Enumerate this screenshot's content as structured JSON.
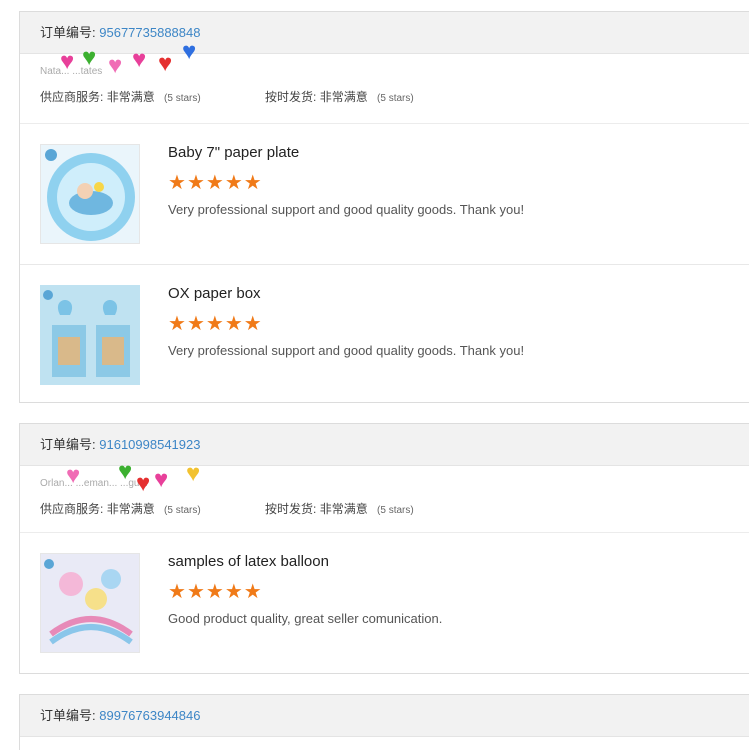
{
  "orders": [
    {
      "label": "订单编号:",
      "number": "95677735888848",
      "buyer": "Nata... ...tates",
      "supplier_label": "供应商服务:",
      "supplier_value": "非常满意",
      "supplier_stars": "(5 stars)",
      "shipping_label": "按时发货:",
      "shipping_value": "非常满意",
      "shipping_stars": "(5 stars)",
      "products": [
        {
          "title": "Baby 7\" paper plate",
          "rating": 5,
          "review": "Very professional support and good quality goods. Thank you!"
        },
        {
          "title": "OX paper box",
          "rating": 5,
          "review": "Very professional support and good quality goods. Thank you!"
        }
      ]
    },
    {
      "label": "订单编号:",
      "number": "91610998541923",
      "buyer": "Orlan... ...eman... ...gu...",
      "supplier_label": "供应商服务:",
      "supplier_value": "非常满意",
      "supplier_stars": "(5 stars)",
      "shipping_label": "按时发货:",
      "shipping_value": "非常满意",
      "shipping_stars": "(5 stars)",
      "products": [
        {
          "title": "samples of latex balloon",
          "rating": 5,
          "review": "Good product quality, great seller comunication."
        }
      ]
    },
    {
      "label": "订单编号:",
      "number": "89976763944846"
    }
  ],
  "star_glyph": "★",
  "colors": {
    "star": "#f07a18",
    "order_number": "#3d86c6",
    "header_bg": "#f2f2f2"
  },
  "emoji_overlays": [
    "heart-stickers",
    "heart-stickers"
  ]
}
